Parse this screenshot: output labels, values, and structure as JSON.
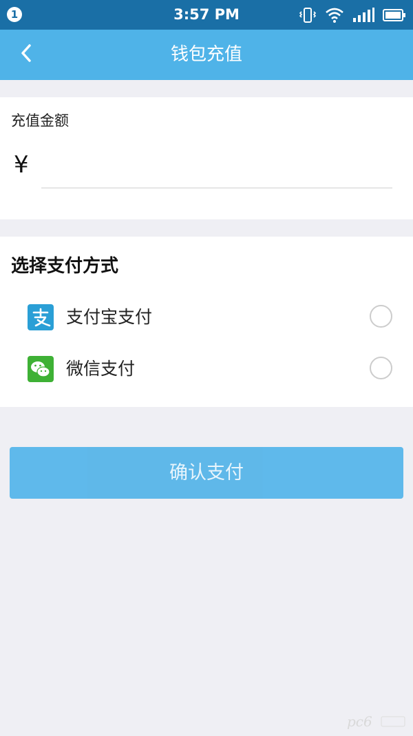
{
  "status_bar": {
    "notification_count": "1",
    "time": "3:57 PM",
    "icons": [
      "vibrate-icon",
      "wifi-icon",
      "signal-icon",
      "battery-icon"
    ]
  },
  "nav": {
    "title": "钱包充值",
    "back_icon": "chevron-left-icon"
  },
  "amount": {
    "label": "充值金额",
    "currency_symbol": "¥",
    "value": "",
    "placeholder": ""
  },
  "payment": {
    "title": "选择支付方式",
    "options": [
      {
        "label": "支付宝支付",
        "icon": "alipay-icon",
        "selected": false
      },
      {
        "label": "微信支付",
        "icon": "wechat-icon",
        "selected": false
      }
    ]
  },
  "confirm": {
    "label": "确认支付"
  },
  "colors": {
    "status_bar": "#1a6fa6",
    "nav_bar": "#4fb3e8",
    "button": "#53b4e9",
    "background": "#efeff4",
    "alipay": "#2a9fd6",
    "wechat": "#3eb135"
  }
}
